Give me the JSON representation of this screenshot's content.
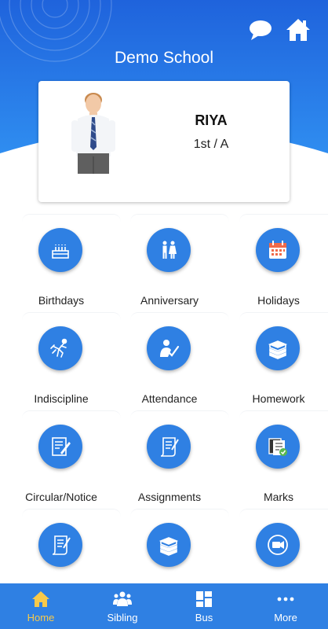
{
  "app": {
    "title": "Demo School"
  },
  "header": {
    "icons": [
      "chat-bubble-icon",
      "home-icon"
    ],
    "colors": {
      "gradient_top": "#1f63dc",
      "gradient_bottom": "#2f8df0"
    }
  },
  "student": {
    "name": "RIYA",
    "class": "1st / A",
    "avatar": "student-photo"
  },
  "grid": {
    "items": [
      {
        "label": "Birthdays",
        "icon": "birthday-cake-icon"
      },
      {
        "label": "Anniversary",
        "icon": "couple-icon"
      },
      {
        "label": "Holidays",
        "icon": "calendar-icon"
      },
      {
        "label": "Indiscipline",
        "icon": "fighting-icon"
      },
      {
        "label": "Attendance",
        "icon": "attendance-check-icon"
      },
      {
        "label": "Homework",
        "icon": "books-icon"
      },
      {
        "label": "Circular/Notice",
        "icon": "notice-icon"
      },
      {
        "label": "Assignments",
        "icon": "scroll-icon"
      },
      {
        "label": "Marks",
        "icon": "marks-certificate-icon"
      },
      {
        "label": "",
        "icon": "scroll-icon"
      },
      {
        "label": "",
        "icon": "books-icon"
      },
      {
        "label": "",
        "icon": "video-camera-icon"
      }
    ]
  },
  "nav": {
    "items": [
      {
        "label": "Home",
        "icon": "home-icon",
        "active": true
      },
      {
        "label": "Sibling",
        "icon": "people-icon",
        "active": false
      },
      {
        "label": "Bus",
        "icon": "grid-icon",
        "active": false
      },
      {
        "label": "More",
        "icon": "more-dots-icon",
        "active": false
      }
    ],
    "colors": {
      "background": "#2f80e3",
      "active": "#f8c94a"
    }
  },
  "accent_color": "#2f80e3"
}
